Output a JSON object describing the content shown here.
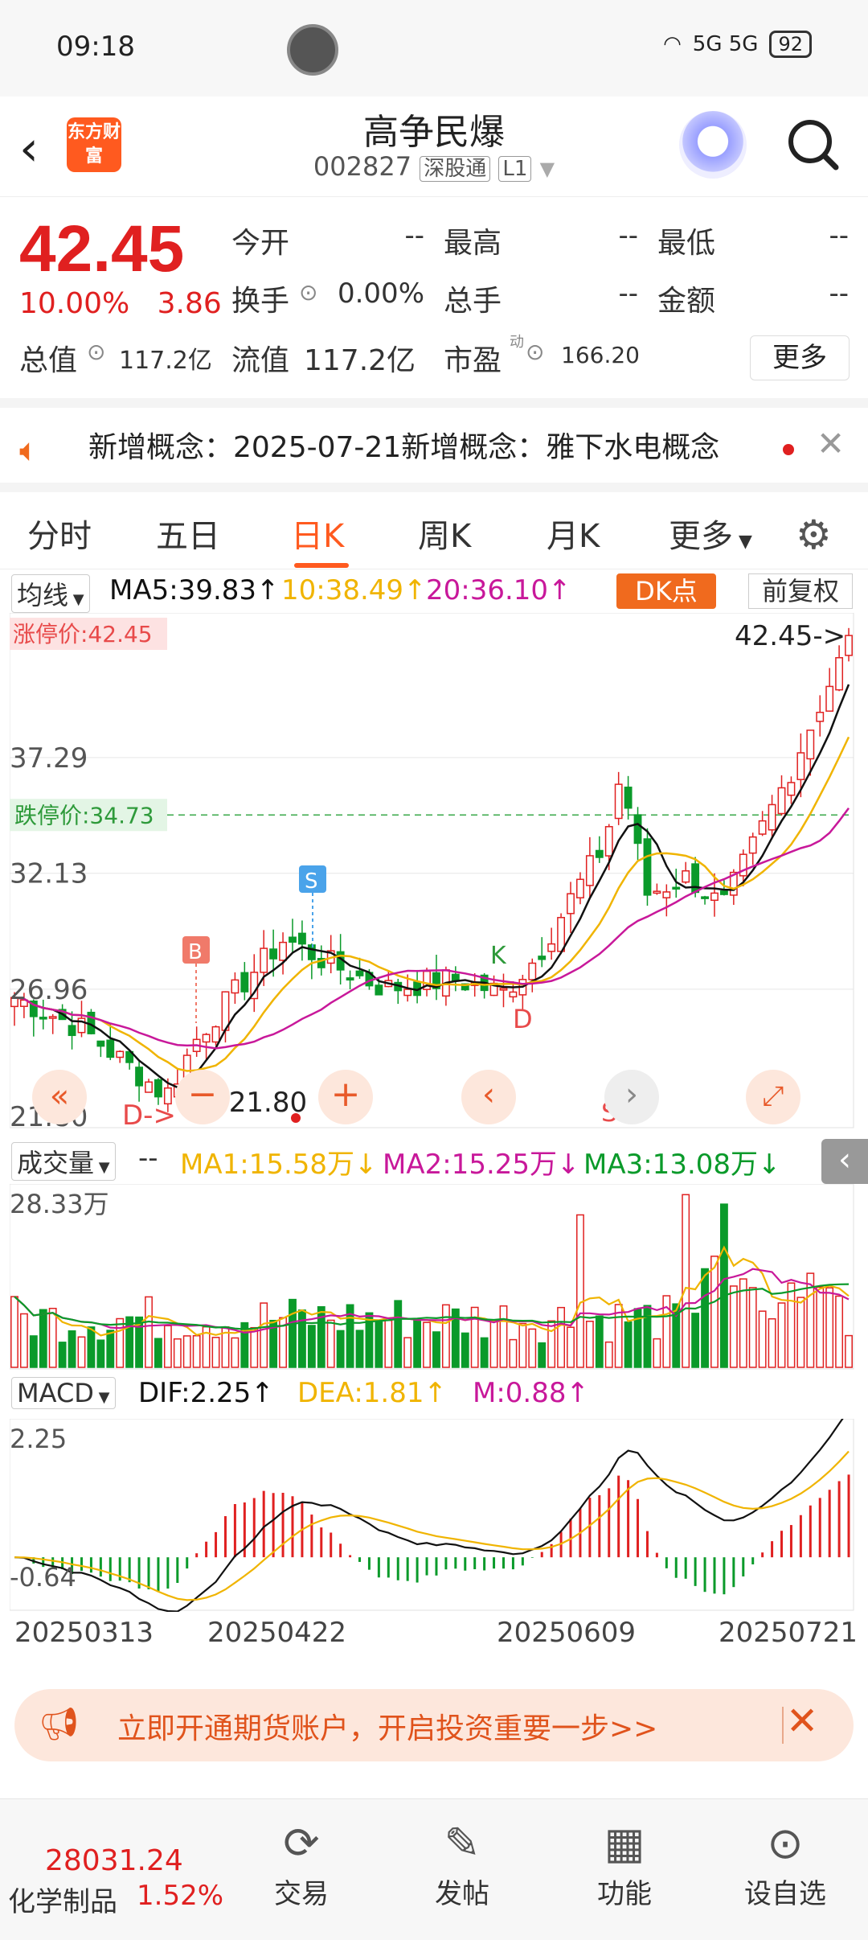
{
  "status_bar": {
    "time": "09:18",
    "signal": "5G 5G",
    "battery": "92"
  },
  "header": {
    "logo": "东方财富",
    "stock_name": "高争民爆",
    "stock_code": "002827",
    "tag1": "深股通",
    "tag2": "L1"
  },
  "quote": {
    "price": "42.45",
    "change_pct": "10.00%",
    "change": "3.86",
    "open_label": "今开",
    "open": "--",
    "high_label": "最高",
    "high": "--",
    "low_label": "最低",
    "low": "--",
    "turnover_label": "换手",
    "turnover": "0.00%",
    "volume_label": "总手",
    "volume": "--",
    "amount_label": "金额",
    "amount": "--",
    "mcap_label": "总值",
    "mcap": "117.2亿",
    "float_label": "流值",
    "float": "117.2亿",
    "pe_label": "市盈",
    "pe_sup": "动",
    "pe": "166.20",
    "more": "更多"
  },
  "notice": {
    "text": "新增概念：2025-07-21新增概念：雅下水电概念"
  },
  "tabs": [
    "分时",
    "五日",
    "日K",
    "周K",
    "月K",
    "更多"
  ],
  "kline": {
    "selector": "均线",
    "ma5": "MA5:39.83",
    "ma10": "10:38.49",
    "ma20": "20:36.10",
    "dk_button": "DK点",
    "fq_button": "前复权",
    "limit_up": "涨停价:42.45",
    "limit_down": "跌停价:34.73",
    "last_price_tag": "42.45->",
    "low_tag": "<-21.80",
    "d_arrow": "D->",
    "y_labels": [
      "37.29",
      "32.13",
      "26.96",
      "21.80"
    ],
    "marker_b": "B",
    "marker_s": "S",
    "marker_k": "K",
    "marker_d": "D",
    "marker_s2": "S"
  },
  "volume": {
    "selector": "成交量",
    "dash": "--",
    "ma1": "MA1:15.58万",
    "ma2": "MA2:15.25万",
    "ma3": "MA3:13.08万",
    "max_label": "28.33万"
  },
  "macd": {
    "selector": "MACD",
    "dif": "DIF:2.25",
    "dea": "DEA:1.81",
    "m": "M:0.88",
    "top_label": "2.25",
    "bottom_label": "-0.64"
  },
  "dates": [
    "20250313",
    "20250422",
    "20250609",
    "20250721"
  ],
  "ad": {
    "text": "立即开通期货账户，开启投资重要一步>>"
  },
  "bottom_bar": {
    "index_value": "28031.24",
    "index_name": "化学制品",
    "index_change": "1.52%",
    "trade": "交易",
    "post": "发帖",
    "function": "功能",
    "watchlist": "设自选"
  },
  "colors": {
    "up": "#e02020",
    "down": "#0a9a2a",
    "accent": "#ff5a1f",
    "ma5": "#111111",
    "ma10": "#f0b400",
    "ma20": "#c8189a"
  }
}
